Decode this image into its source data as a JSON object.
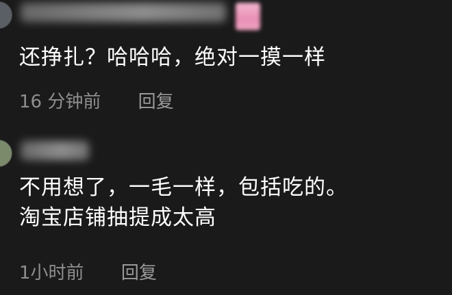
{
  "comments": [
    {
      "text_lines": [
        "还挣扎？哈哈哈，绝对一摸一样"
      ],
      "time": "16 分钟前",
      "reply_label": "回复"
    },
    {
      "text_lines": [
        "不用想了，一毛一样，包括吃的。",
        "淘宝店铺抽提成太高"
      ],
      "time": "1小时前",
      "reply_label": "回复"
    }
  ],
  "colors": {
    "background": "#1a1a1a",
    "text": "#ffffff",
    "meta_text": "#8f8f8f",
    "badge": "#e98fb5"
  },
  "icons": {
    "avatar": "user-avatar-icon"
  }
}
